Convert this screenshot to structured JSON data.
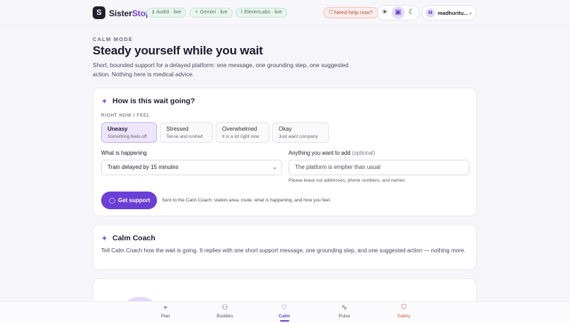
{
  "header": {
    "logo_letter": "S",
    "brand_part1": "Sister",
    "brand_part2": "Stop",
    "status_pills": [
      {
        "icon": "key-icon",
        "glyph": "⚷",
        "label": "Auth0 · live"
      },
      {
        "icon": "sparkle-icon",
        "glyph": "✧",
        "label": "Gemini · live"
      },
      {
        "icon": "waveform-icon",
        "glyph": "⌇",
        "label": "ElevenLabs · live"
      }
    ],
    "help_label": "Need help now?",
    "theme_icons": {
      "light": "☀",
      "chat": "▣",
      "dark": "☾"
    },
    "user": {
      "initial": "M",
      "name": "madhuritu..."
    }
  },
  "intro": {
    "eyebrow": "CALM MODE",
    "title": "Steady yourself while you wait",
    "description": "Short, bounded support for a delayed platform: one message, one grounding step, one suggested action. Nothing here is medical advice."
  },
  "wait_card": {
    "title": "How is this wait going?",
    "feel_label": "RIGHT NOW I FEEL",
    "feelings": [
      {
        "name": "Uneasy",
        "sub": "Something feels off",
        "selected": true
      },
      {
        "name": "Stressed",
        "sub": "Tense and rushed",
        "selected": false
      },
      {
        "name": "Overwhelmed",
        "sub": "It is a lot right now",
        "selected": false
      },
      {
        "name": "Okay",
        "sub": "Just want company",
        "selected": false
      }
    ],
    "happening_label": "What is happening",
    "happening_value": "Train delayed by 15 minutes",
    "add_label": "Anything you want to add",
    "add_optional": "(optional)",
    "add_placeholder": "The platform is emptier than usual",
    "hint": "Please leave out addresses, phone numbers, and names.",
    "button_label": "Get support",
    "button_note": "Sent to the Calm Coach: station area, route, what is happening, and how you feel."
  },
  "coach_card": {
    "title": "Calm Coach",
    "description": "Tell Calm Coach how the wait is going. It replies with one short support message, one grounding step, and one suggested action — nothing more."
  },
  "bottom_nav": [
    {
      "label": "Plan",
      "glyph": "⌖",
      "icon": "map-pin-icon"
    },
    {
      "label": "Buddies",
      "glyph": "⚇",
      "icon": "people-icon"
    },
    {
      "label": "Calm",
      "glyph": "♡",
      "icon": "heart-icon",
      "active": true
    },
    {
      "label": "Pulse",
      "glyph": "∿",
      "icon": "pulse-icon"
    },
    {
      "label": "Safety",
      "glyph": "⛉",
      "icon": "shield-icon"
    }
  ],
  "colors": {
    "accent": "#6b3fd6",
    "safety": "#c0653a",
    "live_green": "#3f7a57"
  }
}
